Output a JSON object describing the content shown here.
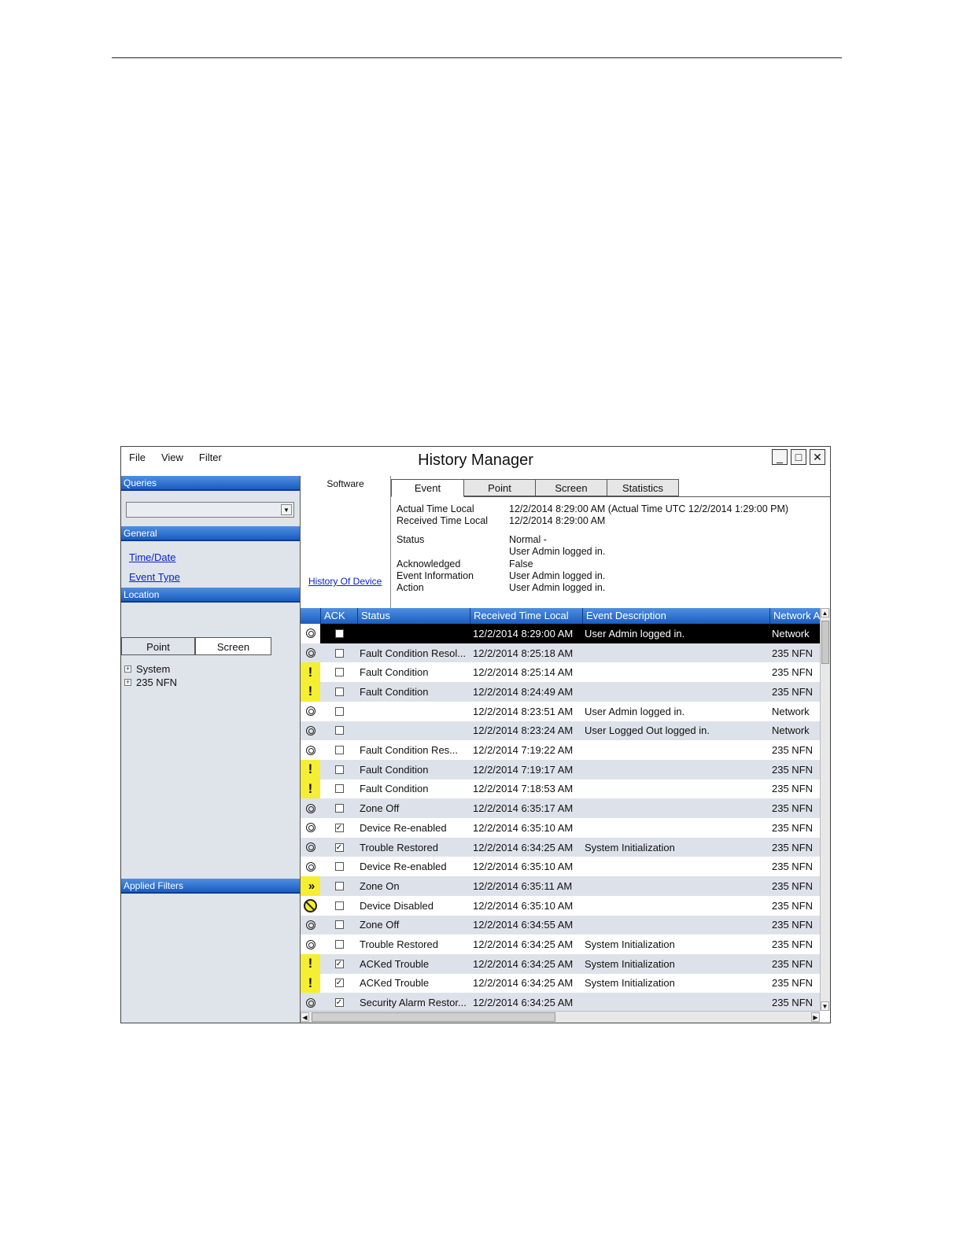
{
  "window": {
    "title": "History Manager",
    "menu": [
      "File",
      "View",
      "Filter"
    ],
    "controls": {
      "minimize": "_",
      "maximize": "□",
      "close": "✕"
    }
  },
  "left_panel": {
    "queries_header": "Queries",
    "query_selected": "",
    "general_header": "General",
    "general_links": [
      "Time/Date",
      "Event Type"
    ],
    "location_header": "Location",
    "location_tabs": [
      "Point",
      "Screen"
    ],
    "tree": [
      "System",
      "235 NFN"
    ],
    "applied_filters_header": "Applied Filters"
  },
  "detail": {
    "software_label": "Software",
    "history_link": "History Of Device",
    "tabs": [
      "Event",
      "Point",
      "Screen",
      "Statistics"
    ],
    "active_tab": "Event",
    "fields": [
      {
        "label": "Actual Time Local",
        "value": "12/2/2014 8:29:00 AM (Actual Time UTC 12/2/2014 1:29:00 PM)"
      },
      {
        "label": "Received Time Local",
        "value": "12/2/2014 8:29:00 AM"
      },
      {
        "label": "Status",
        "value": "Normal -"
      },
      {
        "label": "",
        "value": "User Admin logged in."
      },
      {
        "label": "Acknowledged",
        "value": "False"
      },
      {
        "label": "Event Information",
        "value": "User Admin logged in."
      },
      {
        "label": "Action",
        "value": "User Admin logged in."
      }
    ]
  },
  "grid": {
    "columns": [
      "",
      "ACK",
      "Status",
      "Received Time Local",
      "Event Description",
      "Network A"
    ],
    "rows": [
      {
        "icon": "circle",
        "ack": false,
        "status": "",
        "time": "12/2/2014 8:29:00 AM",
        "desc": "User Admin logged in.",
        "net": "Network",
        "selected": true
      },
      {
        "icon": "circle",
        "ack": false,
        "status": "Fault Condition Resol...",
        "time": "12/2/2014 8:25:18 AM",
        "desc": "",
        "net": "235 NFN"
      },
      {
        "icon": "warning",
        "ack": false,
        "status": "Fault Condition",
        "time": "12/2/2014 8:25:14 AM",
        "desc": "",
        "net": "235 NFN"
      },
      {
        "icon": "warning",
        "ack": false,
        "status": "Fault Condition",
        "time": "12/2/2014 8:24:49 AM",
        "desc": "",
        "net": "235 NFN"
      },
      {
        "icon": "circle",
        "ack": false,
        "status": "",
        "time": "12/2/2014 8:23:51 AM",
        "desc": "User Admin logged in.",
        "net": "Network"
      },
      {
        "icon": "circle",
        "ack": false,
        "status": "",
        "time": "12/2/2014 8:23:24 AM",
        "desc": "User Logged Out logged in.",
        "net": "Network"
      },
      {
        "icon": "circle",
        "ack": false,
        "status": "Fault Condition Res...",
        "time": "12/2/2014 7:19:22 AM",
        "desc": "",
        "net": "235 NFN"
      },
      {
        "icon": "warning",
        "ack": false,
        "status": "Fault Condition",
        "time": "12/2/2014 7:19:17 AM",
        "desc": "",
        "net": "235 NFN"
      },
      {
        "icon": "warning",
        "ack": false,
        "status": "Fault Condition",
        "time": "12/2/2014 7:18:53 AM",
        "desc": "",
        "net": "235 NFN"
      },
      {
        "icon": "circle",
        "ack": false,
        "status": "Zone Off",
        "time": "12/2/2014 6:35:17 AM",
        "desc": "",
        "net": "235 NFN"
      },
      {
        "icon": "circle",
        "ack": true,
        "status": "Device Re-enabled",
        "time": "12/2/2014 6:35:10 AM",
        "desc": "",
        "net": "235 NFN"
      },
      {
        "icon": "circle",
        "ack": true,
        "status": "Trouble Restored",
        "time": "12/2/2014 6:34:25 AM",
        "desc": "System Initialization",
        "net": "235 NFN"
      },
      {
        "icon": "circle",
        "ack": false,
        "status": "Device Re-enabled",
        "time": "12/2/2014 6:35:10 AM",
        "desc": "",
        "net": "235 NFN"
      },
      {
        "icon": "chevron",
        "ack": false,
        "status": "Zone On",
        "time": "12/2/2014 6:35:11 AM",
        "desc": "",
        "net": "235 NFN"
      },
      {
        "icon": "disabled",
        "ack": false,
        "status": "Device Disabled",
        "time": "12/2/2014 6:35:10 AM",
        "desc": "",
        "net": "235 NFN"
      },
      {
        "icon": "circle",
        "ack": false,
        "status": "Zone Off",
        "time": "12/2/2014 6:34:55 AM",
        "desc": "",
        "net": "235 NFN"
      },
      {
        "icon": "circle",
        "ack": false,
        "status": "Trouble Restored",
        "time": "12/2/2014 6:34:25 AM",
        "desc": "System Initialization",
        "net": "235 NFN"
      },
      {
        "icon": "warning",
        "ack": true,
        "status": "ACKed Trouble",
        "time": "12/2/2014 6:34:25 AM",
        "desc": "System Initialization",
        "net": "235 NFN"
      },
      {
        "icon": "warning",
        "ack": true,
        "status": "ACKed Trouble",
        "time": "12/2/2014 6:34:25 AM",
        "desc": "System Initialization",
        "net": "235 NFN"
      },
      {
        "icon": "circle",
        "ack": true,
        "status": "Security Alarm Restor...",
        "time": "12/2/2014 6:34:25 AM",
        "desc": "",
        "net": "235 NFN"
      }
    ]
  },
  "colors": {
    "header_blue": "#1a5dc2",
    "warning_yellow": "#f5ee32",
    "row_alt": "#dde2ea",
    "link": "#0b23c9"
  },
  "icons": {
    "normal": "status-circle-icon",
    "warning": "exclamation-icon",
    "zone_on": "double-chevron-icon",
    "disabled": "no-symbol-icon"
  }
}
